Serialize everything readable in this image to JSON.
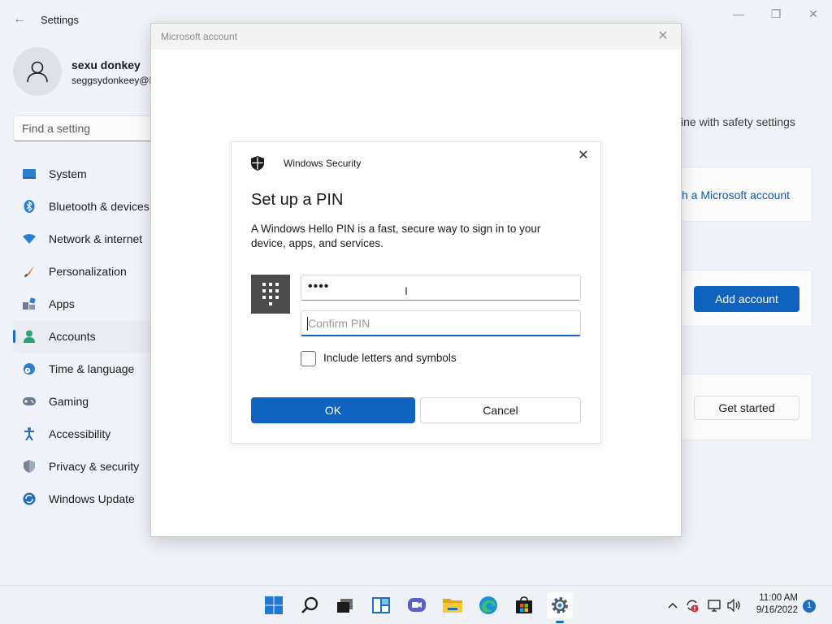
{
  "settings": {
    "title": "Settings",
    "back_icon": "←",
    "window_controls": {
      "minimize": "—",
      "maximize": "❐",
      "close": "✕"
    },
    "user": {
      "name": "sexu donkey",
      "email": "seggsydonkeey@l"
    },
    "search_placeholder": "Find a setting",
    "nav": [
      {
        "label": "System",
        "icon": "system-icon",
        "color": "#2a7fd4"
      },
      {
        "label": "Bluetooth & devices",
        "icon": "bluetooth-icon",
        "color": "#2a7fd4"
      },
      {
        "label": "Network & internet",
        "icon": "wifi-icon",
        "color": "#2a7fd4"
      },
      {
        "label": "Personalization",
        "icon": "brush-icon",
        "color": "#c97a2f"
      },
      {
        "label": "Apps",
        "icon": "apps-icon",
        "color": "#6f7b8c"
      },
      {
        "label": "Accounts",
        "icon": "accounts-icon",
        "color": "#2aa374",
        "active": true
      },
      {
        "label": "Time & language",
        "icon": "globe-clock-icon",
        "color": "#2a7fd4"
      },
      {
        "label": "Gaming",
        "icon": "gamepad-icon",
        "color": "#6f7b8c"
      },
      {
        "label": "Accessibility",
        "icon": "accessibility-icon",
        "color": "#1e6dbf"
      },
      {
        "label": "Privacy & security",
        "icon": "shield-icon",
        "color": "#7a8496"
      },
      {
        "label": "Windows Update",
        "icon": "update-icon",
        "color": "#1e6dbf"
      }
    ],
    "right": {
      "safety_text": "ine with safety settings",
      "ms_account_link": "h a Microsoft account",
      "add_account": "Add account",
      "get_started": "Get started"
    }
  },
  "ms_window": {
    "title": "Microsoft account",
    "close": "✕"
  },
  "dialog": {
    "app_name": "Windows Security",
    "close": "✕",
    "heading": "Set up a PIN",
    "description": "A Windows Hello PIN is a fast, secure way to sign in to your device, apps, and services.",
    "pin_value": "••••",
    "confirm_placeholder": "Confirm PIN",
    "checkbox_label": "Include letters and symbols",
    "ok": "OK",
    "cancel": "Cancel"
  },
  "taskbar": {
    "apps": [
      "start-icon",
      "search-icon",
      "task-view-icon",
      "widgets-icon",
      "chat-icon",
      "file-explorer-icon",
      "edge-icon",
      "store-icon",
      "settings-icon"
    ],
    "time": "11:00 AM",
    "date": "9/16/2022",
    "notifications": "1",
    "tray_chevron": "^",
    "volume_glyph": "🕪"
  },
  "colors": {
    "accent": "#0f62be",
    "background": "#f0f3f9"
  }
}
